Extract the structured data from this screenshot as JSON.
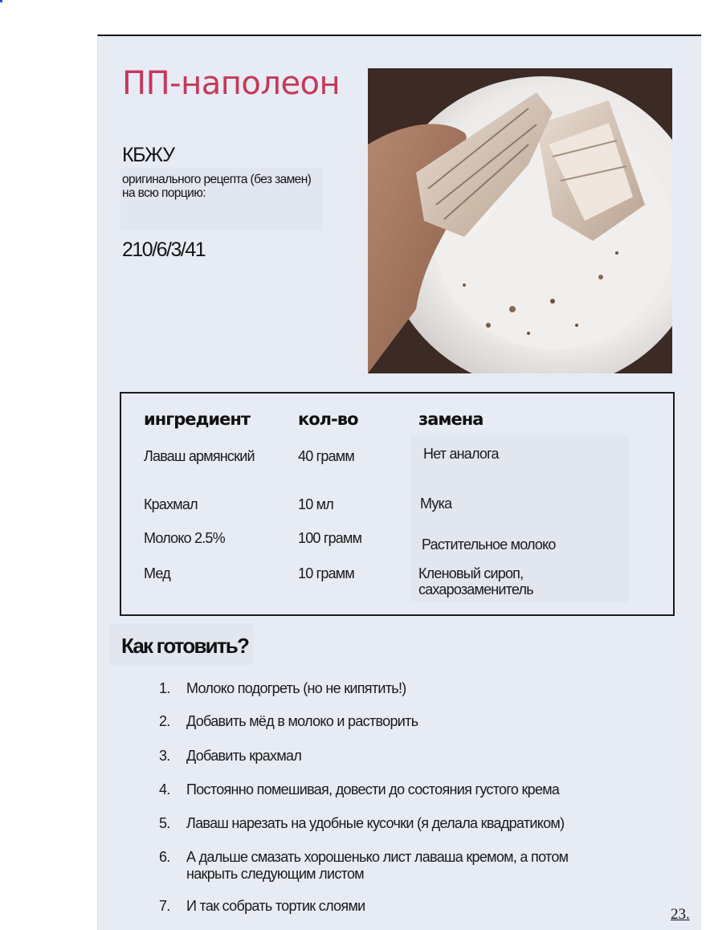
{
  "recipe": {
    "title": "ПП-наполеон",
    "kbju_title": "КБЖУ",
    "kbju_note": "оригинального рецепта (без замен) на всю порцию:",
    "kbju_value": "210/6/3/41"
  },
  "ingredients": {
    "headers": {
      "ingredient": "ингредиент",
      "amount": "кол-во",
      "substitute": "замена"
    },
    "rows": [
      {
        "ingredient": "Лаваш армянский",
        "amount": "40 грамм",
        "substitute": "Нет аналога"
      },
      {
        "ingredient": "Крахмал",
        "amount": "10 мл",
        "substitute": "Мука"
      },
      {
        "ingredient": "Молоко 2.5%",
        "amount": "100 грамм",
        "substitute": "Растительное молоко"
      },
      {
        "ingredient": "Мед",
        "amount": "10 грамм",
        "substitute": "Кленовый сироп, сахарозаменитель"
      }
    ]
  },
  "how_to": {
    "title": "Как готовить?",
    "steps": [
      {
        "num": "1.",
        "text": "Молоко подогреть (но не кипятить!)"
      },
      {
        "num": "2.",
        "text": "Добавить мёд в молоко и растворить"
      },
      {
        "num": "3.",
        "text": "Добавить крахмал"
      },
      {
        "num": "4.",
        "text": "Постоянно помешивая, довести до состояния густого крема"
      },
      {
        "num": "5.",
        "text": "Лаваш нарезать на удобные кусочки (я делала квадратиком)"
      },
      {
        "num": "6.",
        "text": "А дальше смазать хорошенько лист лаваша кремом, а потом накрыть следующим листом"
      },
      {
        "num": "7.",
        "text": "И так собрать тортик слоями"
      }
    ]
  },
  "page_number": "23.",
  "colors": {
    "page_bg": "#e7ebf4",
    "title": "#c4395a",
    "table_border": "#1c1c1c"
  },
  "photo": {
    "icon": "dessert-photo"
  }
}
